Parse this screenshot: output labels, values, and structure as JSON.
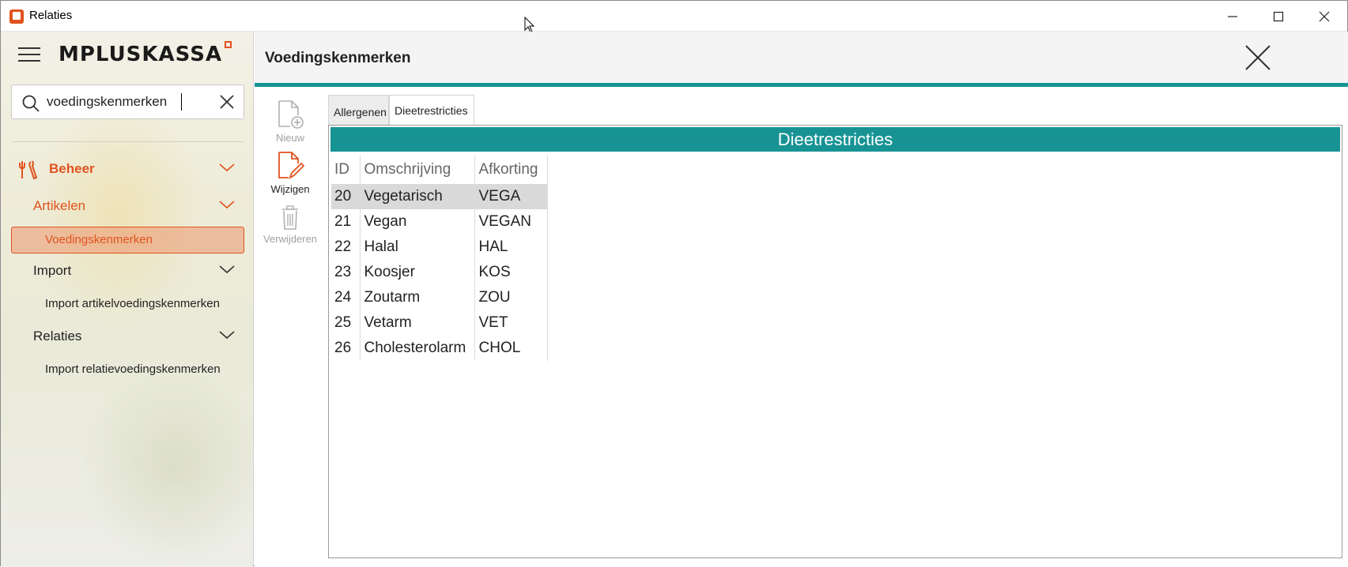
{
  "window": {
    "title": "Relaties"
  },
  "sidebar": {
    "logo": "MPLUSKASSA",
    "search": {
      "value": "voedingskenmerken"
    },
    "nav": {
      "beheer": "Beheer",
      "artikelen": "Artikelen",
      "voedingskenmerken": "Voedingskenmerken",
      "import": "Import",
      "import_artikel": "Import artikelvoedingskenmerken",
      "relaties": "Relaties",
      "import_relatie": "Import relatievoedingskenmerken"
    }
  },
  "main": {
    "title": "Voedingskenmerken",
    "toolbar": {
      "new_label": "Nieuw",
      "edit_label": "Wijzigen",
      "delete_label": "Verwijderen"
    },
    "tabs": [
      "Allergenen",
      "Dieetrestricties"
    ],
    "active_tab": "Dieetrestricties",
    "panel_title": "Dieetrestricties",
    "table": {
      "headers": [
        "ID",
        "Omschrijving",
        "Afkorting"
      ],
      "rows": [
        [
          "20",
          "Vegetarisch",
          "VEGA"
        ],
        [
          "21",
          "Vegan",
          "VEGAN"
        ],
        [
          "22",
          "Halal",
          "HAL"
        ],
        [
          "23",
          "Koosjer",
          "KOS"
        ],
        [
          "24",
          "Zoutarm",
          "ZOU"
        ],
        [
          "25",
          "Vetarm",
          "VET"
        ],
        [
          "26",
          "Cholesterolarm",
          "CHOL"
        ]
      ]
    }
  },
  "colors": {
    "accent": "#e0531f",
    "teal": "#189394"
  }
}
